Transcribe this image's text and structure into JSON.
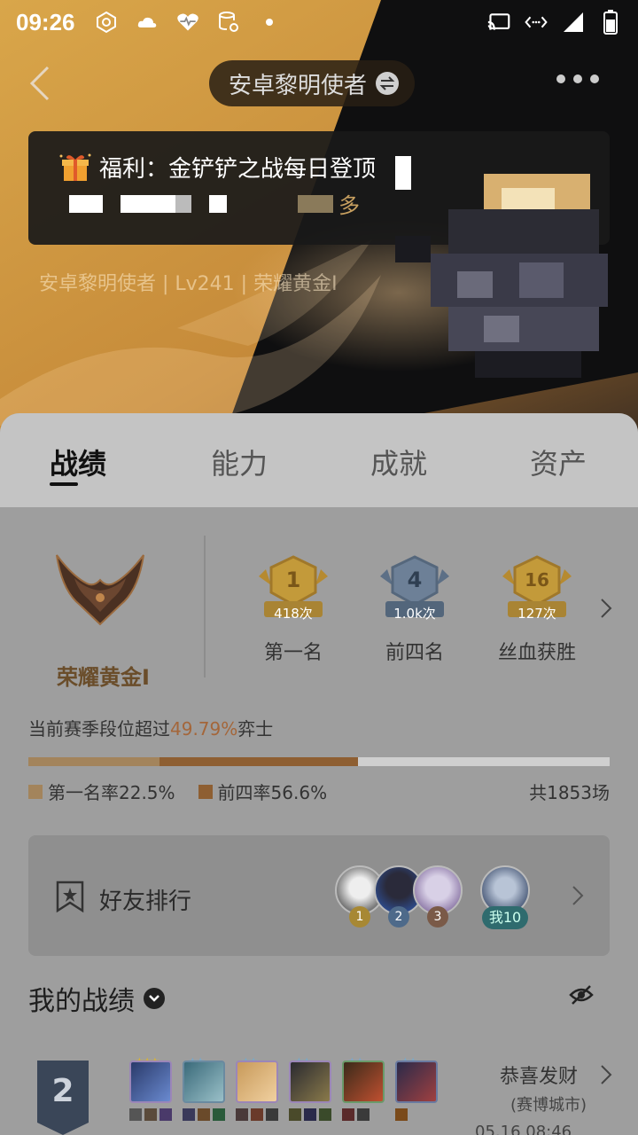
{
  "status_bar": {
    "time": "09:26"
  },
  "header": {
    "account_name": "安卓黎明使者",
    "back_icon": "chevron-left-icon",
    "switch_icon": "switch-icon",
    "more_icon": "more-dots-icon"
  },
  "notice": {
    "title": "福利：金铲铲之战每日登顶",
    "more": "多"
  },
  "profile": {
    "subtitle": "安卓黎明使者 | Lv241 | 荣耀黄金I"
  },
  "tabs": [
    {
      "label": "战绩",
      "active": true
    },
    {
      "label": "能力",
      "active": false
    },
    {
      "label": "成就",
      "active": false
    },
    {
      "label": "资产",
      "active": false
    }
  ],
  "rank": {
    "name": "荣耀黄金I"
  },
  "medals": [
    {
      "number": "1",
      "count": "418次",
      "label": "第一名"
    },
    {
      "number": "4",
      "count": "1.0k次",
      "label": "前四名"
    },
    {
      "number": "16",
      "count": "127次",
      "label": "丝血获胜"
    }
  ],
  "season": {
    "prefix": "当前赛季段位超过",
    "percent": "49.79%",
    "suffix": "弈士",
    "first_rate_label": "第一名率22.5%",
    "top4_rate_label": "前四率56.6%",
    "total": "共1853场",
    "first_rate": 0.225,
    "top4_rate": 0.566
  },
  "friends": {
    "label": "好友排行",
    "ranks": [
      "1",
      "2",
      "3"
    ],
    "me": "我10"
  },
  "my_matches": {
    "title": "我的战绩"
  },
  "match": {
    "place": "2",
    "mode": "恭喜发财",
    "sub": "(赛博城市)",
    "time": "05.16 08:46"
  },
  "colors": {
    "accent_gold": "#c68b3a",
    "rank_text": "#6a4d2a",
    "highlight": "#a4663a",
    "first_bar": "#a3845c",
    "top4_bar": "#8e5f32"
  }
}
